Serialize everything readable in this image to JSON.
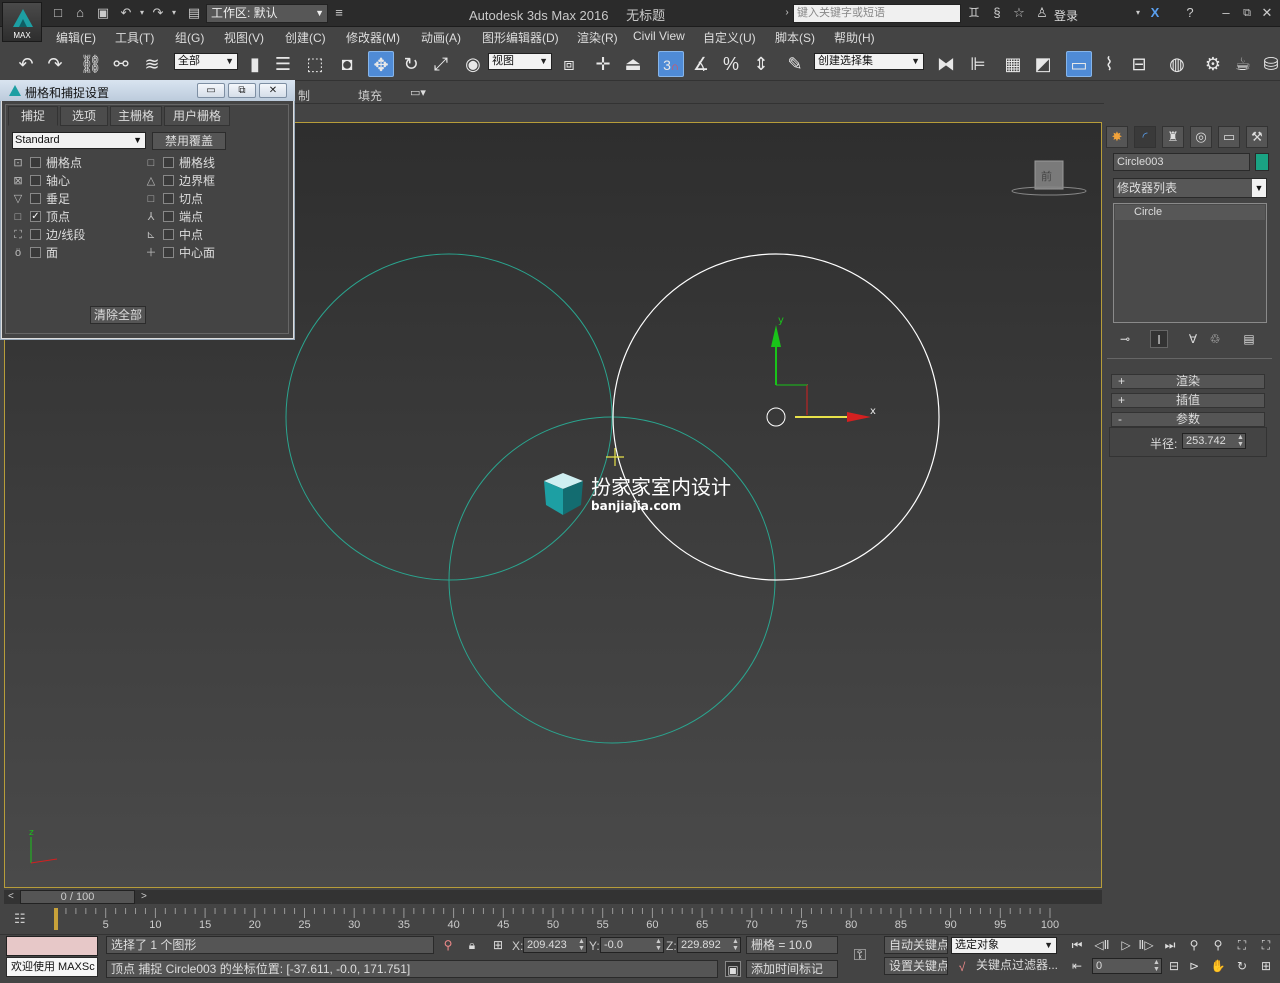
{
  "app": {
    "title": "Autodesk 3ds Max 2016",
    "document": "无标题",
    "logo_label": "MAX",
    "workspace": "工作区: 默认",
    "search_placeholder": "键入关键字或短语",
    "login": "登录"
  },
  "menu": [
    "编辑(E)",
    "工具(T)",
    "组(G)",
    "视图(V)",
    "创建(C)",
    "修改器(M)",
    "动画(A)",
    "图形编辑器(D)",
    "渲染(R)",
    "Civil View",
    "自定义(U)",
    "脚本(S)",
    "帮助(H)"
  ],
  "toolbar": {
    "selection_filter": "全部",
    "ref_coord": "视图",
    "snap_toggle": "3",
    "named_selection": "创建选择集"
  },
  "ribbon": {
    "tab_partial": "制",
    "tab_fill": "填充"
  },
  "dialog": {
    "title": "栅格和捕捉设置",
    "tabs": [
      "捕捉",
      "选项",
      "主栅格",
      "用户栅格"
    ],
    "active_tab": "捕捉",
    "preset": "Standard",
    "override_btn": "禁用覆盖",
    "clear_btn": "清除全部",
    "snaps_left": [
      {
        "label": "栅格点",
        "checked": false
      },
      {
        "label": "轴心",
        "checked": false
      },
      {
        "label": "垂足",
        "checked": false
      },
      {
        "label": "顶点",
        "checked": true
      },
      {
        "label": "边/线段",
        "checked": false
      },
      {
        "label": "面",
        "checked": false
      }
    ],
    "snaps_right": [
      {
        "label": "栅格线",
        "checked": false
      },
      {
        "label": "边界框",
        "checked": false
      },
      {
        "label": "切点",
        "checked": false
      },
      {
        "label": "端点",
        "checked": false
      },
      {
        "label": "中点",
        "checked": false
      },
      {
        "label": "中心面",
        "checked": false
      }
    ]
  },
  "viewport": {
    "viewcube_label": "前",
    "gizmo_x": "x",
    "gizmo_y": "y",
    "axis_z": "z",
    "watermark_title": "扮家家室内设计",
    "watermark_url": "banjiajia.com",
    "colors": {
      "teal_circle": "#2aa58f",
      "selected_circle": "#ffffff",
      "frame": "#b79d3a"
    }
  },
  "command_panel": {
    "object_name": "Circle003",
    "object_color": "#1aa383",
    "modifier_list": "修改器列表",
    "stack": [
      "Circle"
    ],
    "rollouts": [
      {
        "sign": "+",
        "label": "渲染"
      },
      {
        "sign": "+",
        "label": "插值"
      },
      {
        "sign": "-",
        "label": "参数"
      }
    ],
    "radius_label": "半径:",
    "radius_value": "253.742"
  },
  "timeline": {
    "frame_display": "0 / 100",
    "ticks": [
      "5",
      "10",
      "15",
      "20",
      "25",
      "30",
      "35",
      "40",
      "45",
      "50",
      "55",
      "60",
      "65",
      "70",
      "75",
      "80",
      "85",
      "90",
      "95",
      "100"
    ]
  },
  "status": {
    "welcome": "欢迎使用 MAXSc",
    "selection_info": "选择了 1 个图形",
    "prompt": "顶点 捕捉 Circle003 的坐标位置: [-37.611, -0.0, 171.751]",
    "x_label": "X:",
    "x_value": "209.423",
    "y_label": "Y:",
    "y_value": "-0.0",
    "z_label": "Z:",
    "z_value": "229.892",
    "grid": "栅格 = 10.0",
    "add_time_tag": "添加时间标记",
    "auto_key": "自动关键点",
    "set_key": "设置关键点",
    "key_filter_label": "选定对象",
    "key_filters": "关键点过滤器...",
    "frame_field": "0"
  }
}
